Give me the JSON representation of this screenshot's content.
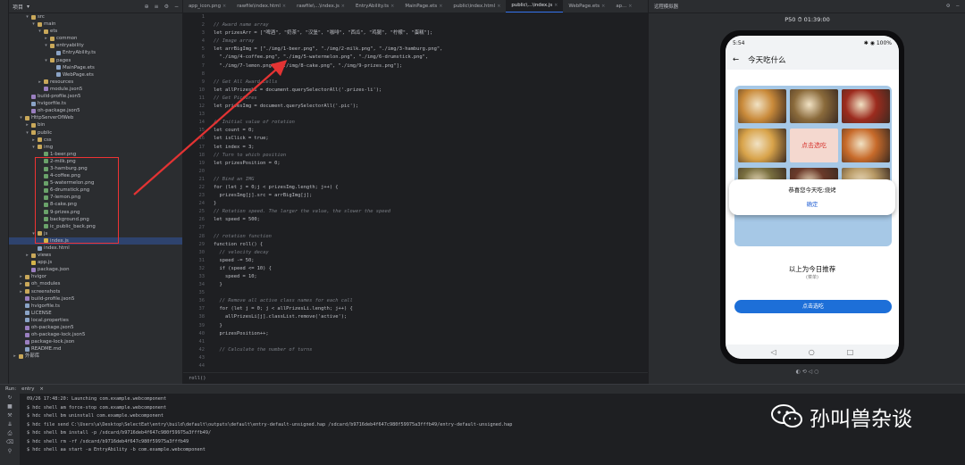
{
  "project": {
    "title": "项目",
    "tree": [
      {
        "label": "src",
        "depth": 1,
        "kind": "folder",
        "arrow": "▾"
      },
      {
        "label": "main",
        "depth": 2,
        "kind": "folder",
        "arrow": "▾"
      },
      {
        "label": "ets",
        "depth": 3,
        "kind": "folder",
        "arrow": "▾"
      },
      {
        "label": "common",
        "depth": 4,
        "kind": "folder",
        "arrow": "▸"
      },
      {
        "label": "entryability",
        "depth": 4,
        "kind": "folder",
        "arrow": "▾"
      },
      {
        "label": "EntryAbility.ts",
        "depth": 5,
        "kind": "file",
        "arrow": ""
      },
      {
        "label": "pages",
        "depth": 4,
        "kind": "folder",
        "arrow": "▾"
      },
      {
        "label": "MainPage.ets",
        "depth": 5,
        "kind": "file",
        "arrow": ""
      },
      {
        "label": "WebPage.ets",
        "depth": 5,
        "kind": "file",
        "arrow": ""
      },
      {
        "label": "resources",
        "depth": 3,
        "kind": "folder",
        "arrow": "▸"
      },
      {
        "label": "module.json5",
        "depth": 3,
        "kind": "json",
        "arrow": ""
      },
      {
        "label": "build-profile.json5",
        "depth": 1,
        "kind": "json",
        "arrow": ""
      },
      {
        "label": "hvigorfile.ts",
        "depth": 1,
        "kind": "file",
        "arrow": ""
      },
      {
        "label": "oh-package.json5",
        "depth": 1,
        "kind": "json",
        "arrow": ""
      },
      {
        "label": "HttpServerOfWeb",
        "depth": 0,
        "kind": "folder",
        "arrow": "▾"
      },
      {
        "label": "bin",
        "depth": 1,
        "kind": "folder",
        "arrow": "▸"
      },
      {
        "label": "public",
        "depth": 1,
        "kind": "folder",
        "arrow": "▾"
      },
      {
        "label": "css",
        "depth": 2,
        "kind": "folder",
        "arrow": "▸"
      },
      {
        "label": "img",
        "depth": 2,
        "kind": "folder",
        "arrow": "▾"
      },
      {
        "label": "1-beer.png",
        "depth": 3,
        "kind": "img",
        "arrow": ""
      },
      {
        "label": "2-milk.png",
        "depth": 3,
        "kind": "img",
        "arrow": ""
      },
      {
        "label": "3-hamburg.png",
        "depth": 3,
        "kind": "img",
        "arrow": ""
      },
      {
        "label": "4-coffee.png",
        "depth": 3,
        "kind": "img",
        "arrow": ""
      },
      {
        "label": "5-watermelon.png",
        "depth": 3,
        "kind": "img",
        "arrow": ""
      },
      {
        "label": "6-drumstick.png",
        "depth": 3,
        "kind": "img",
        "arrow": ""
      },
      {
        "label": "7-lemon.png",
        "depth": 3,
        "kind": "img",
        "arrow": ""
      },
      {
        "label": "8-cake.png",
        "depth": 3,
        "kind": "img",
        "arrow": ""
      },
      {
        "label": "9-prizes.png",
        "depth": 3,
        "kind": "img",
        "arrow": ""
      },
      {
        "label": "background.png",
        "depth": 3,
        "kind": "img",
        "arrow": ""
      },
      {
        "label": "ic_public_back.png",
        "depth": 3,
        "kind": "img",
        "arrow": ""
      },
      {
        "label": "js",
        "depth": 2,
        "kind": "folder",
        "arrow": "▾"
      },
      {
        "label": "index.js",
        "depth": 3,
        "kind": "js",
        "arrow": "",
        "selected": true
      },
      {
        "label": "index.html",
        "depth": 2,
        "kind": "file",
        "arrow": ""
      },
      {
        "label": "views",
        "depth": 1,
        "kind": "folder",
        "arrow": "▸"
      },
      {
        "label": "app.js",
        "depth": 1,
        "kind": "js",
        "arrow": ""
      },
      {
        "label": "package.json",
        "depth": 1,
        "kind": "json",
        "arrow": ""
      },
      {
        "label": "hvigor",
        "depth": 0,
        "kind": "folder",
        "arrow": "▸"
      },
      {
        "label": "oh_modules",
        "depth": 0,
        "kind": "folder",
        "arrow": "▸"
      },
      {
        "label": "screenshots",
        "depth": 0,
        "kind": "folder",
        "arrow": "▸"
      },
      {
        "label": "build-profile.json5",
        "depth": 0,
        "kind": "json",
        "arrow": ""
      },
      {
        "label": "hvigorfile.ts",
        "depth": 0,
        "kind": "file",
        "arrow": ""
      },
      {
        "label": "LICENSE",
        "depth": 0,
        "kind": "file",
        "arrow": ""
      },
      {
        "label": "local.properties",
        "depth": 0,
        "kind": "file",
        "arrow": ""
      },
      {
        "label": "oh-package.json5",
        "depth": 0,
        "kind": "json",
        "arrow": ""
      },
      {
        "label": "oh-package-lock.json5",
        "depth": 0,
        "kind": "json",
        "arrow": ""
      },
      {
        "label": "package-lock.json",
        "depth": 0,
        "kind": "json",
        "arrow": ""
      },
      {
        "label": "README.md",
        "depth": 0,
        "kind": "file",
        "arrow": ""
      },
      {
        "label": "外部库",
        "depth": -1,
        "kind": "folder",
        "arrow": "▸"
      }
    ]
  },
  "tabs": [
    {
      "label": "app_icon.png",
      "active": false
    },
    {
      "label": "rawfile\\index.html",
      "active": false
    },
    {
      "label": "rawfile\\...\\index.js",
      "active": false
    },
    {
      "label": "EntryAbility.ts",
      "active": false
    },
    {
      "label": "MainPage.ets",
      "active": false
    },
    {
      "label": "public\\index.html",
      "active": false
    },
    {
      "label": "public\\...\\index.js",
      "active": true
    },
    {
      "label": "WebPage.ets",
      "active": false
    },
    {
      "label": "ap...",
      "active": false
    }
  ],
  "editor": {
    "start_line": 1,
    "lines": [
      {
        "t": "",
        "c": "code"
      },
      {
        "t": "// Award name array",
        "c": "cm"
      },
      {
        "t": "let prizesArr = [\"啤酒\", \"奶茶\", \"汉堡\", \"咖啡\", \"西瓜\", \"鸡腿\", \"柠檬\", \"蛋糕\"];",
        "c": "code"
      },
      {
        "t": "// Image array",
        "c": "cm"
      },
      {
        "t": "let arrBigImg = [\"./img/1-beer.png\", \"./img/2-milk.png\", \"./img/3-hamburg.png\",",
        "c": "code"
      },
      {
        "t": "  \"./img/4-coffee.png\", \"./img/5-watermelon.png\", \"./img/6-drumstick.png\",",
        "c": "code"
      },
      {
        "t": "  \"./img/7-lemon.png\", \"./img/8-cake.png\", \"./img/9-prizes.png\"];",
        "c": "code"
      },
      {
        "t": "",
        "c": "code"
      },
      {
        "t": "// Get All Award Cells",
        "c": "cm"
      },
      {
        "t": "let allPrizesLi = document.querySelectorAll('.prizes-li');",
        "c": "code"
      },
      {
        "t": "// Get Pictures",
        "c": "cm"
      },
      {
        "t": "let prizesImg = document.querySelectorAll('.pic');",
        "c": "code"
      },
      {
        "t": "",
        "c": "code"
      },
      {
        "t": "// Initial value of rotation",
        "c": "cm"
      },
      {
        "t": "let count = 0;",
        "c": "code"
      },
      {
        "t": "let isClick = true;",
        "c": "code"
      },
      {
        "t": "let index = 3;",
        "c": "code"
      },
      {
        "t": "// Turn to which position",
        "c": "cm"
      },
      {
        "t": "let prizesPosition = 0;",
        "c": "code"
      },
      {
        "t": "",
        "c": "code"
      },
      {
        "t": "// Bind an IMG",
        "c": "cm"
      },
      {
        "t": "for (let j = 0;j < prizesImg.length; j++) {",
        "c": "code"
      },
      {
        "t": "  prizesImg[j].src = arrBigImg[j];",
        "c": "code"
      },
      {
        "t": "}",
        "c": "code"
      },
      {
        "t": "// Rotation speed. The larger the value, the slower the speed",
        "c": "cm"
      },
      {
        "t": "let speed = 500;",
        "c": "code"
      },
      {
        "t": "",
        "c": "code"
      },
      {
        "t": "// rotation function",
        "c": "cm"
      },
      {
        "t": "function roll() {",
        "c": "code"
      },
      {
        "t": "  // velocity decay",
        "c": "cm"
      },
      {
        "t": "  speed -= 50;",
        "c": "code"
      },
      {
        "t": "  if (speed <= 10) {",
        "c": "code"
      },
      {
        "t": "    speed = 10;",
        "c": "code"
      },
      {
        "t": "  }",
        "c": "code"
      },
      {
        "t": "",
        "c": "code"
      },
      {
        "t": "  // Remove all active class names for each call",
        "c": "cm"
      },
      {
        "t": "  for (let j = 0; j < allPrizesLi.length; j++) {",
        "c": "code"
      },
      {
        "t": "    allPrizesLi[j].classList.remove('active');",
        "c": "code"
      },
      {
        "t": "  }",
        "c": "code"
      },
      {
        "t": "  prizesPosition++;",
        "c": "code"
      },
      {
        "t": "",
        "c": "code"
      },
      {
        "t": "  // Calculate the number of turns",
        "c": "cm"
      },
      {
        "t": "",
        "c": "code"
      },
      {
        "t": "",
        "c": "code"
      }
    ],
    "breadcrumb": "roll()"
  },
  "device": {
    "panel_title": "远程模拟器",
    "name": "P50 ⏱ 01:39:00",
    "status_time": "5:54",
    "status_right": "✱ ◉ 100%",
    "app_title": "今天吃什么",
    "board_cell_text": "点击选吃",
    "dialog_message": "恭喜您今天吃:烧烤",
    "dialog_ok": "确定",
    "recommend": "以上为今日推荐",
    "recommend_sub": "(菜单)",
    "draw_button": "点击选吃",
    "cell_colors": [
      "#c98a3a",
      "#8a6a3b",
      "#9c2b1e",
      "#d8a34a",
      "#b6643a",
      "#c76a2a",
      "#7a7040",
      "#6b3a2a",
      "#b89a66"
    ],
    "board_color": "#a6c8e6",
    "accent": "#1d6fd8",
    "footer_icons": "◐ ⟲ ◁ ○"
  },
  "run": {
    "tab_label": "Run:",
    "config": "entry",
    "lines": [
      "09/26 17:48:20: Launching com.example.webcomponent",
      "$ hdc shell am force-stop com.example.webcomponent",
      "$ hdc shell bm uninstall com.example.webcomponent",
      "$ hdc file send C:\\Users\\a\\Desktop\\SelectEat\\entry\\build\\default\\outputs\\default\\entry-default-unsigned.hap /sdcard/b9716deb4f647c980f59975a3fffb49/entry-default-unsigned.hap",
      "$ hdc shell bm install -p /sdcard/b9716deb4f647c980f59975a3fffb49/",
      "$ hdc shell rm -rf /sdcard/b9716deb4f647c980f59975a3fffb49",
      "$ hdc shell aa start -a EntryAbility -b com.example.webcomponent"
    ]
  },
  "watermark": {
    "text": "孙叫兽杂谈",
    "icon": "wechat-icon"
  },
  "annotation_color": "#e33333"
}
